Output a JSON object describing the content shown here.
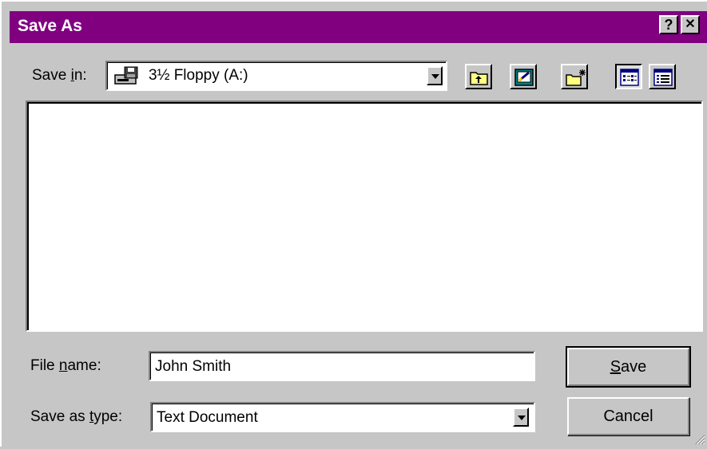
{
  "window": {
    "title": "Save As",
    "help_glyph": "?",
    "close_glyph": "✕"
  },
  "save_in": {
    "label_before": "Save ",
    "label_hotkey": "i",
    "label_after": "n:",
    "value": "3½ Floppy (A:)",
    "icon": "floppy-drive-icon"
  },
  "toolbar": {
    "icons": [
      "up-one-level-icon",
      "desktop-icon",
      "new-folder-icon",
      "list-view-icon",
      "details-view-icon"
    ]
  },
  "file_name": {
    "label_before": "File ",
    "label_hotkey": "n",
    "label_after": "ame:",
    "value": "John Smith"
  },
  "save_as_type": {
    "label_before": "Save as ",
    "label_hotkey": "t",
    "label_after": "ype:",
    "value": "Text Document"
  },
  "buttons": {
    "save_hotkey": "S",
    "save_rest": "ave",
    "cancel": "Cancel"
  },
  "colors": {
    "titlebar": "#800080",
    "face": "#c6c6c6"
  }
}
